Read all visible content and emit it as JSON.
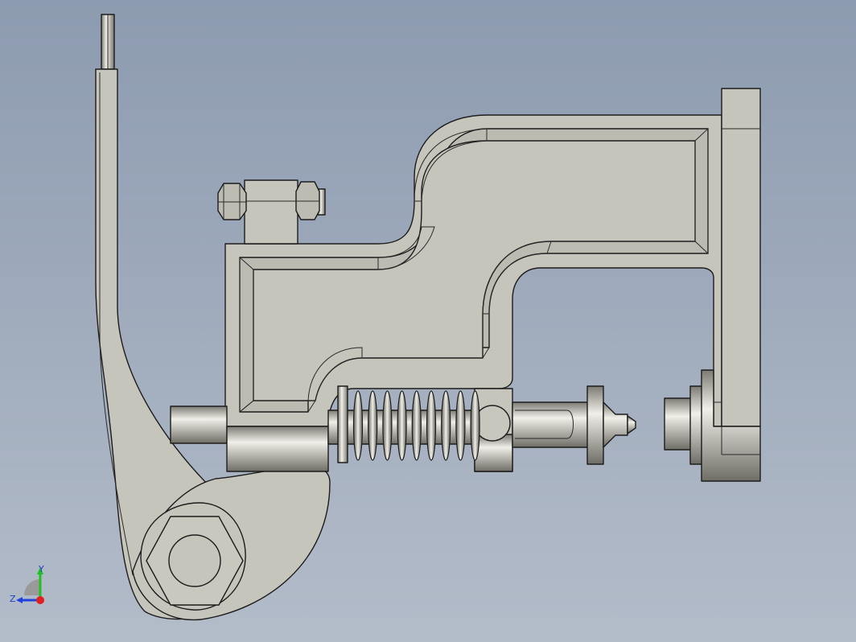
{
  "view": {
    "background_top": "#8d9bb0",
    "background_bottom": "#b3bcc9",
    "part_color": "#c6c5bc"
  },
  "triad": {
    "y_label": "Y",
    "z_label": "Z",
    "x_color": "#e02020",
    "y_color": "#20c020",
    "z_color": "#2040e0"
  },
  "parts": [
    {
      "name": "lever-arm"
    },
    {
      "name": "c-frame"
    },
    {
      "name": "clamp-bolt"
    },
    {
      "name": "compression-spring"
    },
    {
      "name": "plunger"
    },
    {
      "name": "anvil-die"
    },
    {
      "name": "pivot-pin"
    }
  ]
}
